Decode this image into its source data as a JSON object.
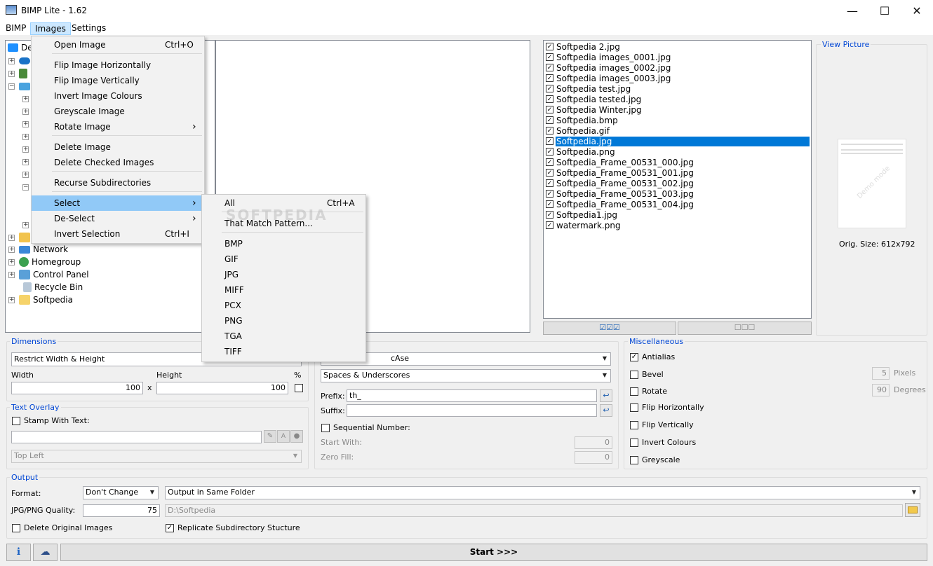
{
  "window": {
    "title": "BIMP Lite - 1.62",
    "minimize": "—",
    "maximize": "☐",
    "close": "✕"
  },
  "menubar": [
    "BIMP",
    "Images",
    "Settings"
  ],
  "images_menu": {
    "items": [
      {
        "label": "Open Image",
        "shortcut": "Ctrl+O"
      },
      {
        "label": "Flip Image Horizontally"
      },
      {
        "label": "Flip Image Vertically"
      },
      {
        "label": "Invert Image Colours"
      },
      {
        "label": "Greyscale Image"
      },
      {
        "label": "Rotate Image",
        "submenu": "›"
      },
      {
        "label": "Delete Image"
      },
      {
        "label": "Delete Checked Images"
      },
      {
        "label": "Recurse Subdirectories"
      },
      {
        "label": "Select",
        "submenu": "›"
      },
      {
        "label": "De-Select",
        "submenu": "›"
      },
      {
        "label": "Invert Selection",
        "shortcut": "Ctrl+I"
      }
    ]
  },
  "select_submenu": {
    "items": [
      {
        "label": "All",
        "shortcut": "Ctrl+A"
      },
      {
        "label": "That Match Pattern..."
      },
      {
        "label": "BMP"
      },
      {
        "label": "GIF"
      },
      {
        "label": "JPG"
      },
      {
        "label": "MIFF"
      },
      {
        "label": "PCX"
      },
      {
        "label": "PNG"
      },
      {
        "label": "TGA"
      },
      {
        "label": "TIFF"
      }
    ]
  },
  "tree": {
    "root_partial": "De",
    "items": [
      "Network",
      "Homegroup",
      "Control Panel",
      "Recycle Bin",
      "Softpedia"
    ]
  },
  "files": [
    "Softpedia 2.jpg",
    "Softpedia images_0001.jpg",
    "Softpedia images_0002.jpg",
    "Softpedia images_0003.jpg",
    "Softpedia test.jpg",
    "Softpedia tested.jpg",
    "Softpedia Winter.jpg",
    "Softpedia.bmp",
    "Softpedia.gif",
    "Softpedia.jpg",
    "Softpedia.png",
    "Softpedia_Frame_00531_000.jpg",
    "Softpedia_Frame_00531_001.jpg",
    "Softpedia_Frame_00531_002.jpg",
    "Softpedia_Frame_00531_003.jpg",
    "Softpedia_Frame_00531_004.jpg",
    "Softpedia1.jpg",
    "watermark.png"
  ],
  "selected_file": "Softpedia.jpg",
  "check_all_icon": "☑☑☑",
  "uncheck_all_icon": "☐☐☐",
  "view_picture": {
    "title": "View Picture",
    "orig_size": "Orig. Size: 612x792",
    "watermark": "Demo mode"
  },
  "dimensions": {
    "title": "Dimensions",
    "mode": "Restrict Width & Height",
    "width_label": "Width",
    "height_label": "Height",
    "percent_label": "%",
    "width": "100",
    "height": "100",
    "x": "x"
  },
  "text_overlay": {
    "title": "Text Overlay",
    "stamp_label": "Stamp With Text:",
    "position": "Top Left"
  },
  "rename": {
    "case": "cAse",
    "spaces": "Spaces & Underscores",
    "prefix_label": "Prefix:",
    "prefix": "th_",
    "suffix_label": "Suffix:",
    "suffix": "",
    "seq_label": "Sequential Number:",
    "start_label": "Start With:",
    "start": "0",
    "zero_label": "Zero Fill:",
    "zero": "0"
  },
  "misc": {
    "title": "Miscellaneous",
    "antialias": "Antialias",
    "bevel": "Bevel",
    "rotate": "Rotate",
    "flip_h": "Flip Horizontally",
    "flip_v": "Flip Vertically",
    "invert": "Invert Colours",
    "grey": "Greyscale",
    "pixels_val": "5",
    "pixels": "Pixels",
    "degrees_val": "90",
    "degrees": "Degrees"
  },
  "output": {
    "title": "Output",
    "format_label": "Format:",
    "format": "Don't Change",
    "folder_mode": "Output in Same Folder",
    "quality_label": "JPG/PNG Quality:",
    "quality": "75",
    "path": "D:\\Softpedia",
    "delete_orig": "Delete Original Images",
    "replicate": "Replicate Subdirectory Stucture"
  },
  "start_button": "Start >>>",
  "watermark_text": "SOFTPEDIA"
}
